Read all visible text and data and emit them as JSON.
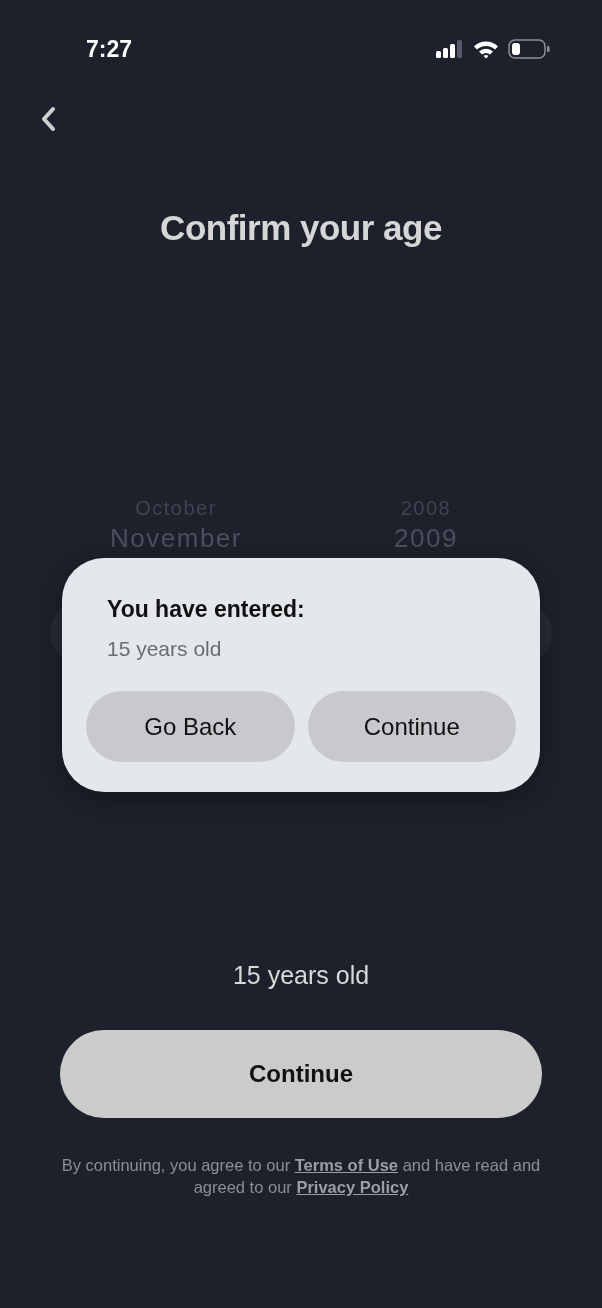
{
  "status_bar": {
    "time": "7:27"
  },
  "title": "Confirm your age",
  "picker": {
    "months": [
      "October",
      "November"
    ],
    "years": [
      "2008",
      "2009"
    ]
  },
  "age_display": "15 years old",
  "continue_button": "Continue",
  "footer": {
    "text": "By continuing, you agree to our **Terms of Use** and have read and agreed to our **Privacy Policy**"
  },
  "dialog": {
    "title": "You have entered:",
    "message": "15 years old",
    "buttons": [
      "Go Back",
      "Continue"
    ]
  }
}
